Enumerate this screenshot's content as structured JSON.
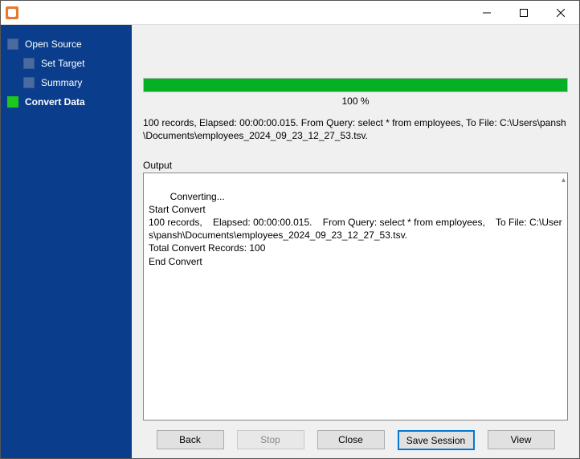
{
  "sidebar": {
    "items": [
      {
        "label": "Open Source"
      },
      {
        "label": "Set Target"
      },
      {
        "label": "Summary"
      },
      {
        "label": "Convert Data"
      }
    ]
  },
  "progress": {
    "percent_label": "100 %",
    "fill_width": "100%"
  },
  "summary_text": "100 records,    Elapsed: 00:00:00.015.    From Query: select * from employees,    To File: C:\\Users\\pansh\\Documents\\employees_2024_09_23_12_27_53.tsv.",
  "output": {
    "label": "Output",
    "text": "Converting...\nStart Convert\n100 records,    Elapsed: 00:00:00.015.    From Query: select * from employees,    To File: C:\\Users\\pansh\\Documents\\employees_2024_09_23_12_27_53.tsv.\nTotal Convert Records: 100\nEnd Convert"
  },
  "buttons": {
    "back": "Back",
    "stop": "Stop",
    "close": "Close",
    "save_session": "Save Session",
    "view": "View"
  }
}
